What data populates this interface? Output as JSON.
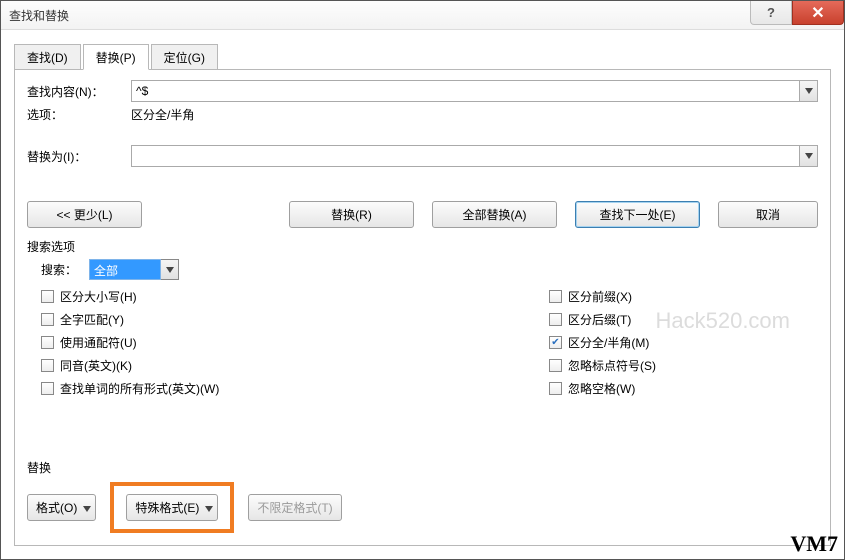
{
  "window": {
    "title": "查找和替换"
  },
  "tabs": {
    "find": "查找(D)",
    "replace": "替换(P)",
    "goto": "定位(G)"
  },
  "fields": {
    "find_label": "查找内容(N)：",
    "find_value": "^$",
    "options_label": "选项：",
    "options_value": "区分全/半角",
    "replace_label": "替换为(I)："
  },
  "buttons": {
    "less": "<< 更少(L)",
    "replace": "替换(R)",
    "replace_all": "全部替换(A)",
    "find_next": "查找下一处(E)",
    "cancel": "取消"
  },
  "search_options": {
    "group_label": "搜索选项",
    "search_label": "搜索：",
    "search_value": "全部",
    "left": {
      "case": "区分大小写(H)",
      "whole": "全字匹配(Y)",
      "wildcard": "使用通配符(U)",
      "sounds": "同音(英文)(K)",
      "wordforms": "查找单词的所有形式(英文)(W)"
    },
    "right": {
      "prefix": "区分前缀(X)",
      "suffix": "区分后缀(T)",
      "width": "区分全/半角(M)",
      "punct": "忽略标点符号(S)",
      "spaces": "忽略空格(W)"
    }
  },
  "bottom": {
    "label": "替换",
    "format": "格式(O)",
    "special": "特殊格式(E)",
    "noformat": "不限定格式(T)"
  },
  "watermark": "Hack520.com",
  "badge": "VM7"
}
